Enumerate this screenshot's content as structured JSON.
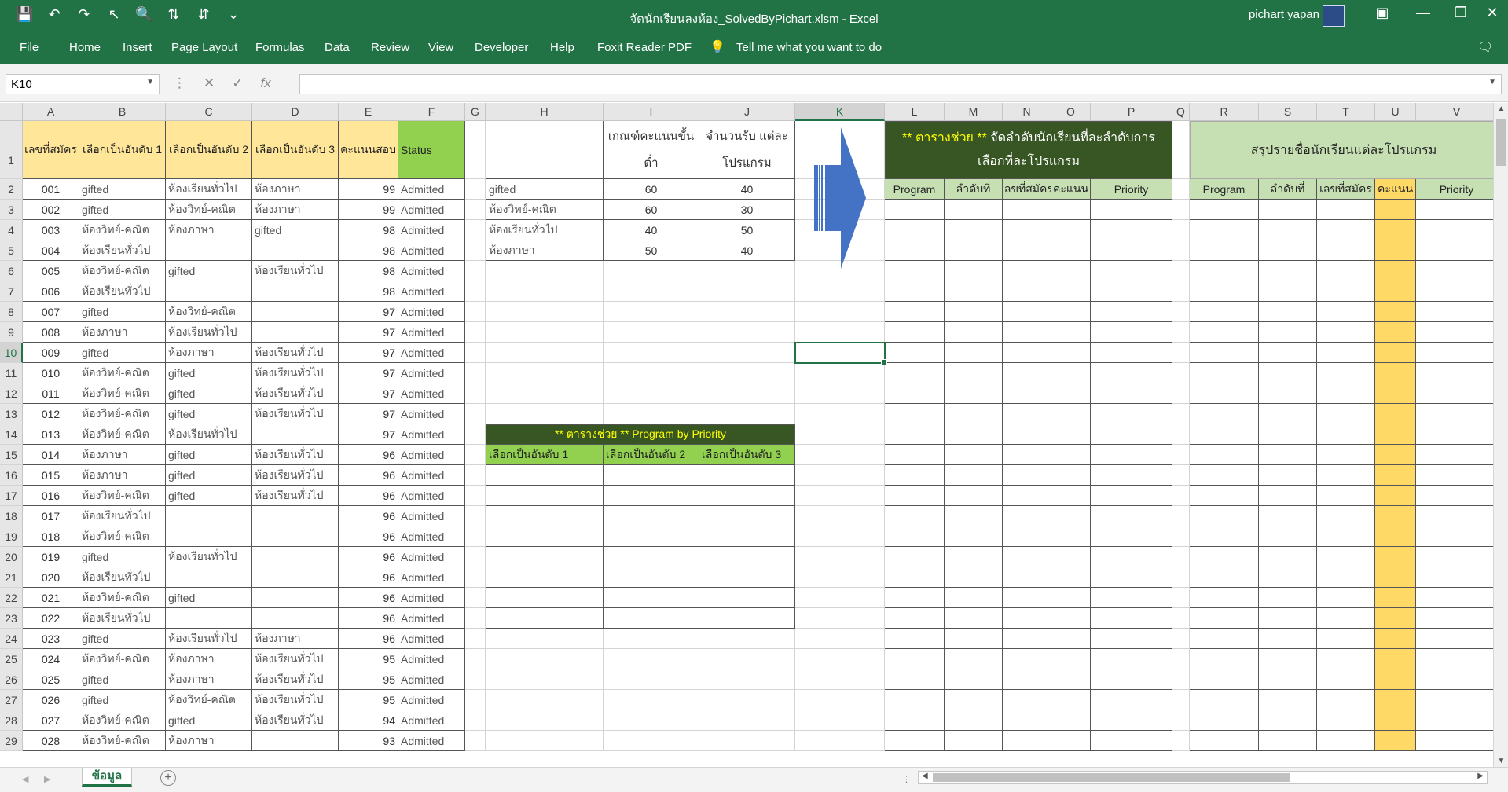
{
  "window": {
    "title": "จัดนักเรียนลงห้อง_SolvedByPichart.xlsm  -  Excel",
    "user": "pichart yapan"
  },
  "ribbon_tabs": [
    "File",
    "Home",
    "Insert",
    "Page Layout",
    "Formulas",
    "Data",
    "Review",
    "View",
    "Developer",
    "Help",
    "Foxit Reader PDF"
  ],
  "tell_me": "Tell me what you want to do",
  "formula_bar": {
    "name_box": "K10",
    "formula": ""
  },
  "columns": [
    "A",
    "B",
    "C",
    "D",
    "E",
    "F",
    "G",
    "H",
    "I",
    "J",
    "K",
    "L",
    "M",
    "N",
    "O",
    "P",
    "Q",
    "R",
    "S",
    "T",
    "U",
    "V"
  ],
  "selected_column": "K",
  "selected_row": 10,
  "rows": [
    "1",
    "2",
    "3",
    "4",
    "5",
    "6",
    "7",
    "8",
    "9",
    "10",
    "11",
    "12",
    "13",
    "14",
    "15",
    "16",
    "17",
    "18",
    "19",
    "20",
    "21",
    "22",
    "23",
    "24",
    "25",
    "26",
    "27",
    "28",
    "29"
  ],
  "main_table": {
    "headers": [
      "เลขที่สมัคร",
      "เลือกเป็นอันดับ 1",
      "เลือกเป็นอันดับ 2",
      "เลือกเป็นอันดับ 3",
      "คะแนนสอบ",
      "Status"
    ],
    "rows": [
      [
        "001",
        "gifted",
        "ห้องเรียนทั่วไป",
        "ห้องภาษา",
        "99",
        "Admitted"
      ],
      [
        "002",
        "gifted",
        "ห้องวิทย์-คณิต",
        "ห้องภาษา",
        "99",
        "Admitted"
      ],
      [
        "003",
        "ห้องวิทย์-คณิต",
        "ห้องภาษา",
        "gifted",
        "98",
        "Admitted"
      ],
      [
        "004",
        "ห้องเรียนทั่วไป",
        "",
        "",
        "98",
        "Admitted"
      ],
      [
        "005",
        "ห้องวิทย์-คณิต",
        "gifted",
        "ห้องเรียนทั่วไป",
        "98",
        "Admitted"
      ],
      [
        "006",
        "ห้องเรียนทั่วไป",
        "",
        "",
        "98",
        "Admitted"
      ],
      [
        "007",
        "gifted",
        "ห้องวิทย์-คณิต",
        "",
        "97",
        "Admitted"
      ],
      [
        "008",
        "ห้องภาษา",
        "ห้องเรียนทั่วไป",
        "",
        "97",
        "Admitted"
      ],
      [
        "009",
        "gifted",
        "ห้องภาษา",
        "ห้องเรียนทั่วไป",
        "97",
        "Admitted"
      ],
      [
        "010",
        "ห้องวิทย์-คณิต",
        "gifted",
        "ห้องเรียนทั่วไป",
        "97",
        "Admitted"
      ],
      [
        "011",
        "ห้องวิทย์-คณิต",
        "gifted",
        "ห้องเรียนทั่วไป",
        "97",
        "Admitted"
      ],
      [
        "012",
        "ห้องวิทย์-คณิต",
        "gifted",
        "ห้องเรียนทั่วไป",
        "97",
        "Admitted"
      ],
      [
        "013",
        "ห้องวิทย์-คณิต",
        "ห้องเรียนทั่วไป",
        "",
        "97",
        "Admitted"
      ],
      [
        "014",
        "ห้องภาษา",
        "gifted",
        "ห้องเรียนทั่วไป",
        "96",
        "Admitted"
      ],
      [
        "015",
        "ห้องภาษา",
        "gifted",
        "ห้องเรียนทั่วไป",
        "96",
        "Admitted"
      ],
      [
        "016",
        "ห้องวิทย์-คณิต",
        "gifted",
        "ห้องเรียนทั่วไป",
        "96",
        "Admitted"
      ],
      [
        "017",
        "ห้องเรียนทั่วไป",
        "",
        "",
        "96",
        "Admitted"
      ],
      [
        "018",
        "ห้องวิทย์-คณิต",
        "",
        "",
        "96",
        "Admitted"
      ],
      [
        "019",
        "gifted",
        "ห้องเรียนทั่วไป",
        "",
        "96",
        "Admitted"
      ],
      [
        "020",
        "ห้องเรียนทั่วไป",
        "",
        "",
        "96",
        "Admitted"
      ],
      [
        "021",
        "ห้องวิทย์-คณิต",
        "gifted",
        "",
        "96",
        "Admitted"
      ],
      [
        "022",
        "ห้องเรียนทั่วไป",
        "",
        "",
        "96",
        "Admitted"
      ],
      [
        "023",
        "gifted",
        "ห้องเรียนทั่วไป",
        "ห้องภาษา",
        "96",
        "Admitted"
      ],
      [
        "024",
        "ห้องวิทย์-คณิต",
        "ห้องภาษา",
        "ห้องเรียนทั่วไป",
        "95",
        "Admitted"
      ],
      [
        "025",
        "gifted",
        "ห้องภาษา",
        "ห้องเรียนทั่วไป",
        "95",
        "Admitted"
      ],
      [
        "026",
        "gifted",
        "ห้องวิทย์-คณิต",
        "ห้องเรียนทั่วไป",
        "95",
        "Admitted"
      ],
      [
        "027",
        "ห้องวิทย์-คณิต",
        "gifted",
        "ห้องเรียนทั่วไป",
        "94",
        "Admitted"
      ],
      [
        "028",
        "ห้องวิทย์-คณิต",
        "ห้องภาษา",
        "",
        "93",
        "Admitted"
      ]
    ]
  },
  "criteria_table": {
    "headers": [
      "",
      "เกณฑ์คะแนนขั้นต่ำ",
      "จำนวนรับ แต่ละโปรแกรม"
    ],
    "rows": [
      [
        "gifted",
        "60",
        "40"
      ],
      [
        "ห้องวิทย์-คณิต",
        "60",
        "30"
      ],
      [
        "ห้องเรียนทั่วไป",
        "40",
        "50"
      ],
      [
        "ห้องภาษา",
        "50",
        "40"
      ]
    ]
  },
  "priority_table": {
    "banner_marker": "** ตารางช่วย",
    "banner_text": "** Program by Priority",
    "headers": [
      "เลือกเป็นอันดับ 1",
      "เลือกเป็นอันดับ 2",
      "เลือกเป็นอันดับ 3"
    ]
  },
  "helper_table": {
    "banner_marker": "** ตารางช่วย **",
    "banner_text": "จัดลำดับนักเรียนที่ละลำดับการเลือกที่ละโปรแกรม",
    "headers": [
      "Program",
      "ลำดับที่",
      "เลขที่สมัคร",
      "คะแนน",
      "Priority"
    ]
  },
  "summary_table": {
    "banner_text": "สรุปรายชื่อนักเรียนแต่ละโปรแกรม",
    "headers": [
      "Program",
      "ลำดับที่",
      "เลขที่สมัคร",
      "คะแนน",
      "Priority"
    ]
  },
  "sheet_tabs": [
    "ข้อมูล"
  ],
  "colors": {
    "excel_green": "#217346",
    "header_yellow": "#ffe699",
    "status_green": "#92d050",
    "dark_green": "#375623",
    "light_green": "#c6e0b4",
    "arrow_blue": "#4472c4",
    "highlight_yellow": "#ffd966"
  }
}
